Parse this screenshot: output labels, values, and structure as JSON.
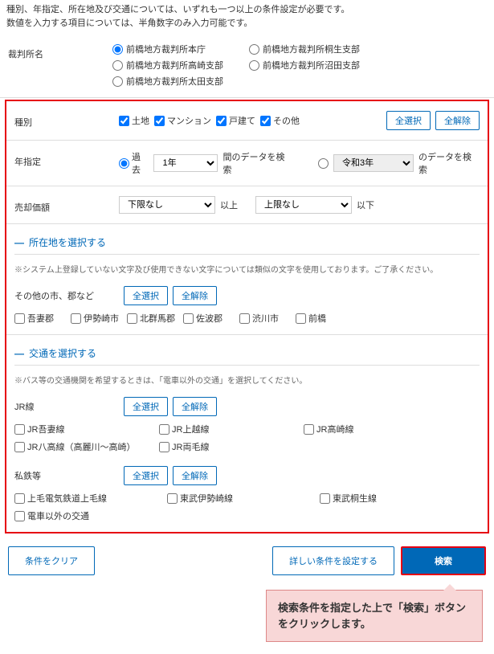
{
  "intro": {
    "l1": "種別、年指定、所在地及び交通については、いずれも一つ以上の条件設定が必要です。",
    "l2": "数値を入力する項目については、半角数字のみ入力可能です。"
  },
  "court": {
    "label": "裁判所名",
    "options": [
      "前橋地方裁判所本庁",
      "前橋地方裁判所桐生支部",
      "前橋地方裁判所高崎支部",
      "前橋地方裁判所沼田支部",
      "前橋地方裁判所太田支部"
    ]
  },
  "type": {
    "label": "種別",
    "items": [
      "土地",
      "マンション",
      "戸建て",
      "その他"
    ],
    "selectAll": "全選択",
    "clearAll": "全解除"
  },
  "year": {
    "label": "年指定",
    "past": "過去",
    "period": "1年",
    "between": "間のデータを検索",
    "era": "令和3年",
    "search": "のデータを検索"
  },
  "price": {
    "label": "売却価額",
    "lowerNone": "下限なし",
    "ge": "以上",
    "upperNone": "上限なし",
    "le": "以下"
  },
  "location": {
    "header": "所在地を選択する",
    "note": "※システム上登録していない文字及び使用できない文字については類似の文字を使用しております。ご了承ください。",
    "group": "その他の市、郡など",
    "selectAll": "全選択",
    "clearAll": "全解除",
    "items": [
      "吾妻郡",
      "伊勢崎市",
      "北群馬郡",
      "佐波郡",
      "渋川市",
      "前橋"
    ]
  },
  "transport": {
    "header": "交通を選択する",
    "note": "※バス等の交通機関を希望するときは、「電車以外の交通」を選択してください。",
    "jr": {
      "title": "JR線",
      "selectAll": "全選択",
      "clearAll": "全解除",
      "items": [
        "JR吾妻線",
        "JR上越線",
        "JR高崎線",
        "JR八高線（高麗川～高崎）",
        "JR両毛線"
      ]
    },
    "private": {
      "title": "私鉄等",
      "selectAll": "全選択",
      "clearAll": "全解除",
      "items": [
        "上毛電気鉄道上毛線",
        "東武伊勢崎線",
        "東武桐生線",
        "電車以外の交通"
      ]
    }
  },
  "footer": {
    "clear": "条件をクリア",
    "detail": "詳しい条件を設定する",
    "search": "検索"
  },
  "callout": "検索条件を指定した上で「検索」ボタンをクリックします。"
}
